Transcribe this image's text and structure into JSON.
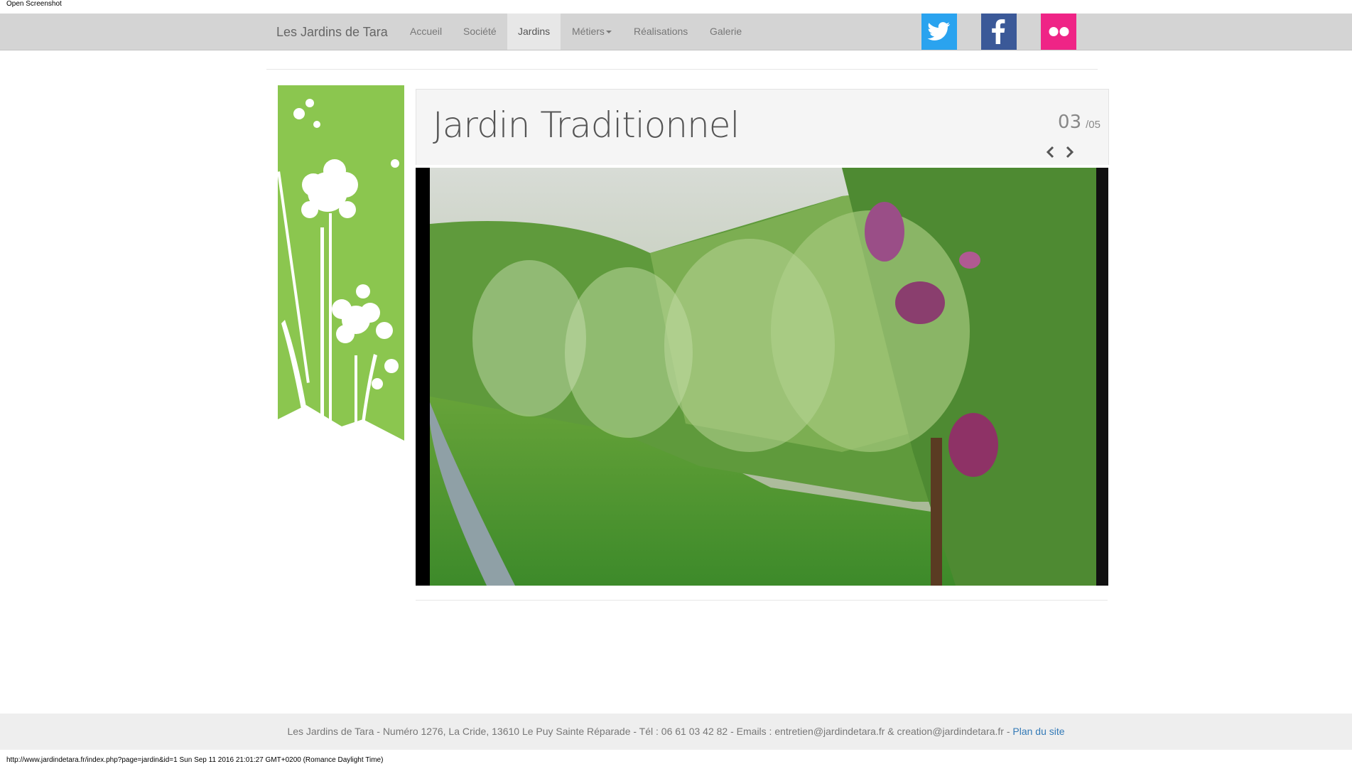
{
  "window": {
    "top_note": "Open Screenshot"
  },
  "navbar": {
    "brand": "Les Jardins de Tara",
    "items": [
      {
        "label": "Accueil"
      },
      {
        "label": "Société"
      },
      {
        "label": "Jardins"
      },
      {
        "label": "Métiers"
      },
      {
        "label": "Réalisations"
      },
      {
        "label": "Galerie"
      }
    ],
    "social": [
      "twitter-icon",
      "facebook-icon",
      "flickr-icon"
    ]
  },
  "main": {
    "title": "Jardin Traditionnel",
    "counter_current": "03",
    "counter_total": "/05"
  },
  "footer": {
    "text": "Les Jardins de Tara - Numéro 1276, La Cride, 13610 Le Puy Sainte Réparade - Tél : 06 61 03 42 82 - Emails : entretien@jardindetara.fr & creation@jardindetara.fr - ",
    "link": "Plan du site"
  },
  "status_bar": "http://www.jardindetara.fr/index.php?page=jardin&id=1 Sun Sep 11 2016 21:01:27 GMT+0200 (Romance Daylight Time)",
  "colors": {
    "twitter": "#2aa3ef",
    "facebook": "#3b5998",
    "flickr": "#ef2486",
    "side_panel": "#8bc64f"
  }
}
